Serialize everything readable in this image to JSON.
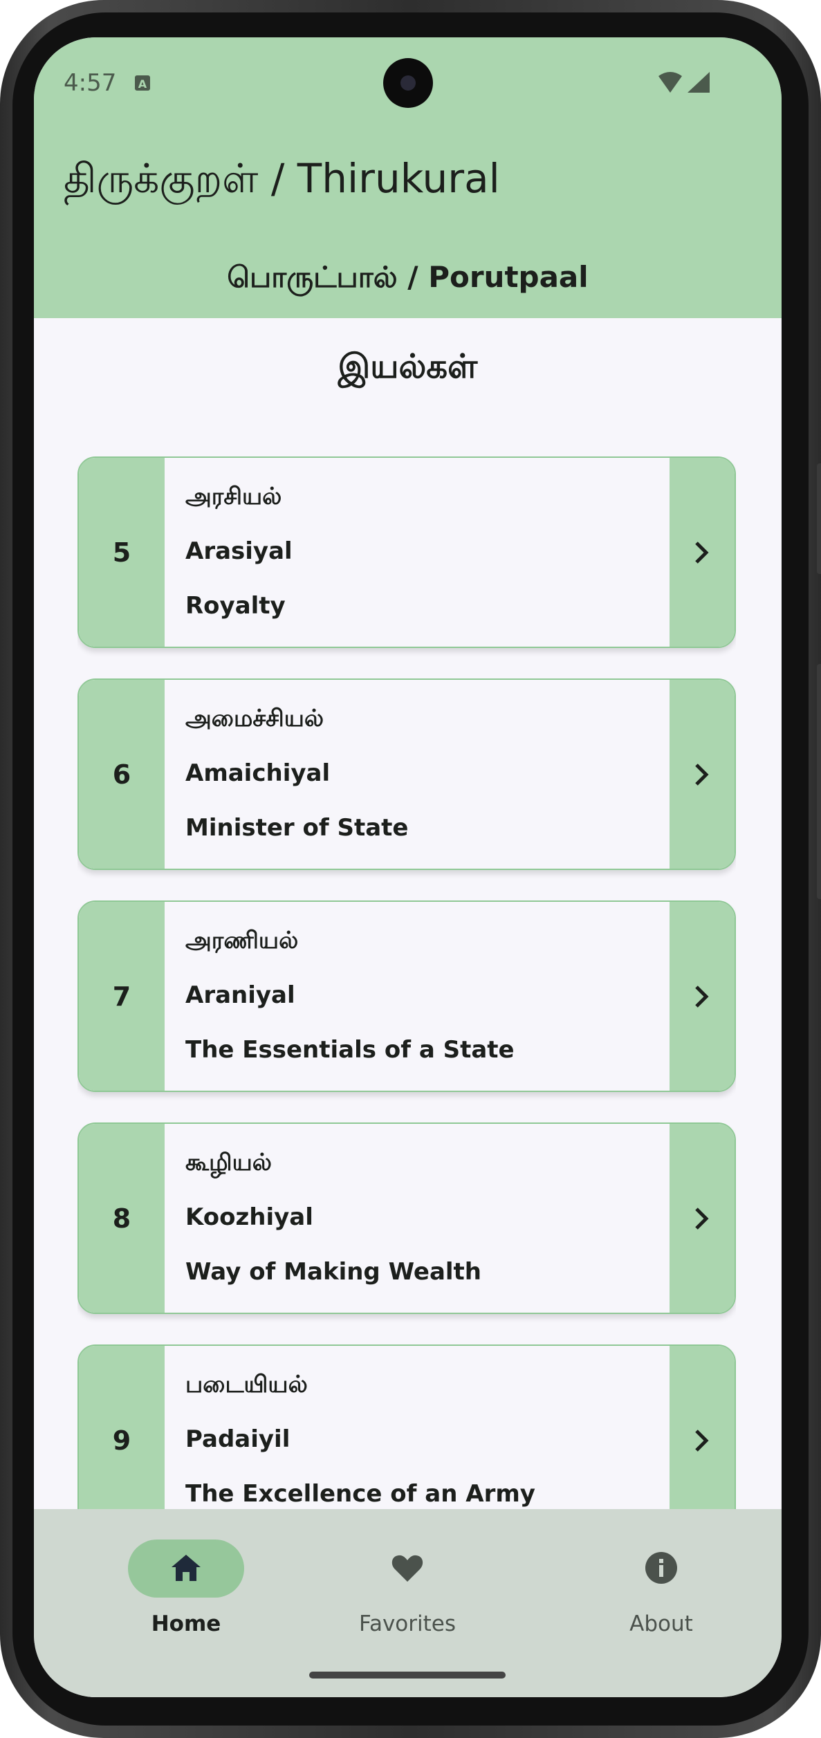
{
  "status_bar": {
    "time": "4:57",
    "notification_icon": "text-recognition-icon",
    "icons": [
      "wifi-icon",
      "cell-signal-icon"
    ]
  },
  "app": {
    "title": "திருக்குறள் / Thirukural",
    "section": "பொருட்பால் / Porutpaal"
  },
  "page": {
    "heading": "இயல்கள்"
  },
  "chapters": [
    {
      "number": "5",
      "tamil": "அரசியல்",
      "transliteration": "Arasiyal",
      "english": "Royalty"
    },
    {
      "number": "6",
      "tamil": "அமைச்சியல்",
      "transliteration": "Amaichiyal",
      "english": "Minister of State"
    },
    {
      "number": "7",
      "tamil": "அரணியல்",
      "transliteration": "Araniyal",
      "english": "The Essentials of a State"
    },
    {
      "number": "8",
      "tamil": "கூழியல்",
      "transliteration": "Koozhiyal",
      "english": "Way of Making Wealth"
    },
    {
      "number": "9",
      "tamil": "படையியல்",
      "transliteration": "Padaiyil",
      "english": "The Excellence of an Army"
    }
  ],
  "bottom_nav": [
    {
      "label": "Home",
      "icon": "home-icon",
      "selected": true
    },
    {
      "label": "Favorites",
      "icon": "heart-icon",
      "selected": false
    },
    {
      "label": "About",
      "icon": "info-icon",
      "selected": false
    }
  ],
  "colors": {
    "primary": "#abd6af",
    "nav_background": "#cfd8d0",
    "selected_pill": "#96c79b",
    "surface": "#f7f6fb"
  }
}
